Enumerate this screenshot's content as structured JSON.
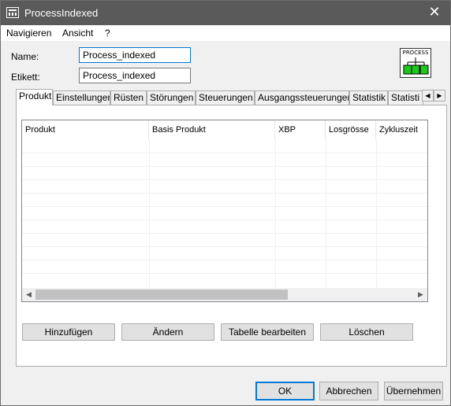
{
  "window": {
    "title": "ProcessIndexed"
  },
  "menu": [
    "Navigieren",
    "Ansicht",
    "?"
  ],
  "form": {
    "name_label": "Name:",
    "name_value": "Process_indexed",
    "etikett_label": "Etikett:",
    "etikett_value": "Process_indexed"
  },
  "process_icon": {
    "label": "PROCESS"
  },
  "tabs": [
    "Produkt",
    "Einstellungen",
    "Rüsten",
    "Störungen",
    "Steuerungen",
    "Ausgangssteuerungen",
    "Statistik",
    "Statisti"
  ],
  "active_tab": "Produkt",
  "table": {
    "columns": [
      "Produkt",
      "Basis Produkt",
      "XBP",
      "Losgrösse",
      "Zykluszeit"
    ],
    "rows": []
  },
  "buttons": {
    "add": "Hinzufügen",
    "edit": "Ändern",
    "edit_table": "Tabelle bearbeiten",
    "delete": "Löschen"
  },
  "footer": {
    "ok": "OK",
    "cancel": "Abbrechen",
    "apply": "Übernehmen"
  }
}
